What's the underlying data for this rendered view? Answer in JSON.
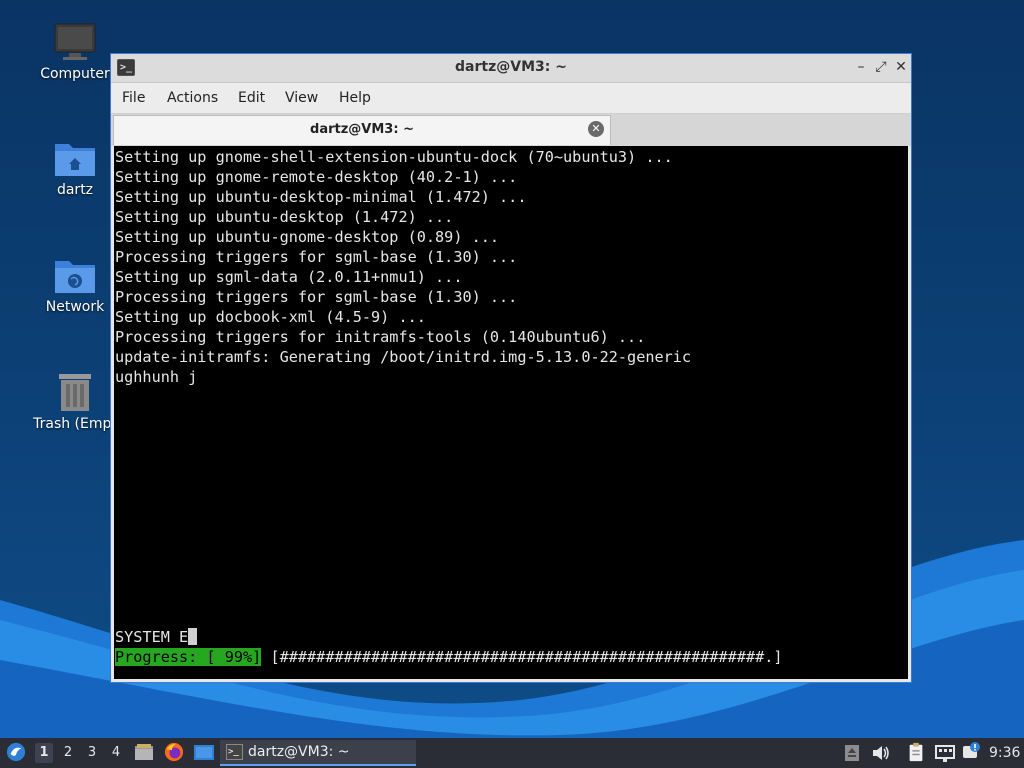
{
  "desktop": {
    "icons": [
      {
        "label": "Computer",
        "icon": "computer-icon"
      },
      {
        "label": "dartz",
        "icon": "home-folder-icon"
      },
      {
        "label": "Network",
        "icon": "network-folder-icon"
      },
      {
        "label": "Trash (Empt",
        "icon": "trash-icon"
      }
    ]
  },
  "window": {
    "title": "dartz@VM3: ~",
    "controls": {
      "minimize": "–",
      "maximize": "⤢",
      "close": "✕"
    },
    "menu": [
      "File",
      "Actions",
      "Edit",
      "View",
      "Help"
    ],
    "tab": {
      "label": "dartz@VM3: ~",
      "close": "✕"
    }
  },
  "terminal": {
    "lines": [
      "Setting up gnome-shell-extension-ubuntu-dock (70~ubuntu3) ...",
      "Setting up gnome-remote-desktop (40.2-1) ...",
      "Setting up ubuntu-desktop-minimal (1.472) ...",
      "Setting up ubuntu-desktop (1.472) ...",
      "Setting up ubuntu-gnome-desktop (0.89) ...",
      "Processing triggers for sgml-base (1.30) ...",
      "Setting up sgml-data (2.0.11+nmu1) ...",
      "Processing triggers for sgml-base (1.30) ...",
      "Setting up docbook-xml (4.5-9) ...",
      "Processing triggers for initramfs-tools (0.140ubuntu6) ...",
      "update-initramfs: Generating /boot/initrd.img-5.13.0-22-generic",
      "ughhunh j"
    ],
    "input_line": "SYSTEM E",
    "progress_label": "Progress: [ 99%]",
    "progress_bar": " [#####################################################.]",
    "progress_percent": 99,
    "progress_color": "#27a71f"
  },
  "taskbar": {
    "workspaces": [
      "1",
      "2",
      "3",
      "4"
    ],
    "active_workspace": "1",
    "launchers": [
      "file-manager-icon",
      "firefox-icon",
      "desktop-icon"
    ],
    "window_button": "dartz@VM3: ~",
    "tray": [
      "update-icon",
      "volume-icon",
      "clipboard-icon",
      "network-icon",
      "notification-icon"
    ],
    "clock": "9:36"
  },
  "colors": {
    "accent": "#3b7ad8",
    "terminal_bg": "#000000",
    "terminal_fg": "#e6e6e6",
    "taskbar_bg": "#2a2d35"
  }
}
